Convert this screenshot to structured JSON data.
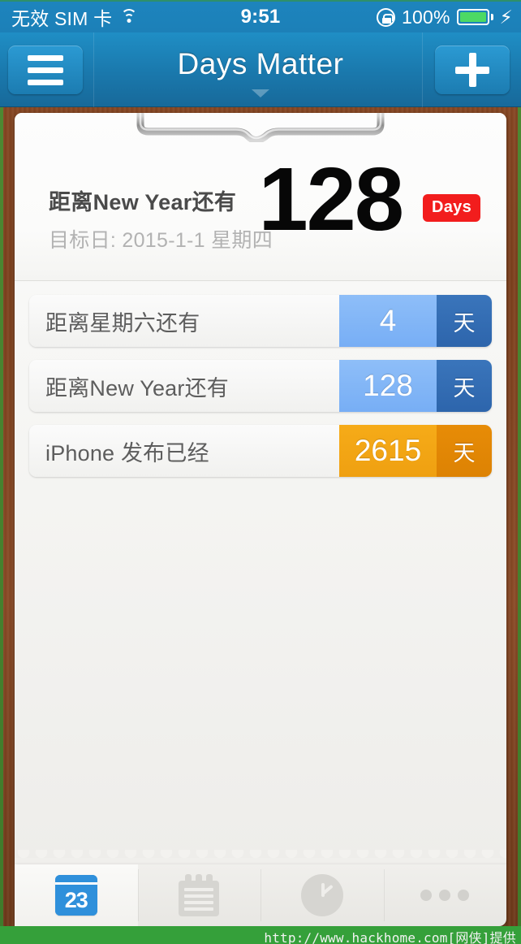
{
  "status_bar": {
    "carrier": "无效 SIM 卡",
    "wifi_icon": "wifi-icon",
    "time": "9:51",
    "rotation_lock_icon": "rotation-lock-icon",
    "battery_percent": "100%",
    "battery_icon": "battery-full-icon",
    "charging_icon": "⚡",
    "battery_color": "#4cd964",
    "bar_color": "#1d84bd"
  },
  "nav_bar": {
    "title": "Days Matter",
    "menu_icon": "hamburger-menu-icon",
    "add_icon": "plus-icon",
    "chevron_icon": "chevron-down-icon",
    "bar_color": "#1a78ac"
  },
  "featured": {
    "title": "距离New Year还有",
    "subtitle": "目标日: 2015-1-1 星期四",
    "count": "128",
    "badge_label": "Days",
    "badge_color": "#f21d1d"
  },
  "list": [
    {
      "label": "距离星期六还有",
      "value": "4",
      "unit": "天",
      "value_color": "#7faef5",
      "unit_color": "#2d65ac"
    },
    {
      "label": "距离New Year还有",
      "value": "128",
      "unit": "天",
      "value_color": "#7faef5",
      "unit_color": "#2d65ac"
    },
    {
      "label": "iPhone 发布已经",
      "value": "2615",
      "unit": "天",
      "value_color": "#efa011",
      "unit_color": "#dd8203"
    }
  ],
  "tab_bar": [
    {
      "icon": "calendar-icon",
      "day_number": "23",
      "active": true
    },
    {
      "icon": "notepad-icon",
      "active": false
    },
    {
      "icon": "clock-icon",
      "active": false
    },
    {
      "icon": "more-dots-icon",
      "active": false
    }
  ],
  "watermark": {
    "text": "http://www.hackhome.com[网侠]提供",
    "background": "#35a03a"
  }
}
